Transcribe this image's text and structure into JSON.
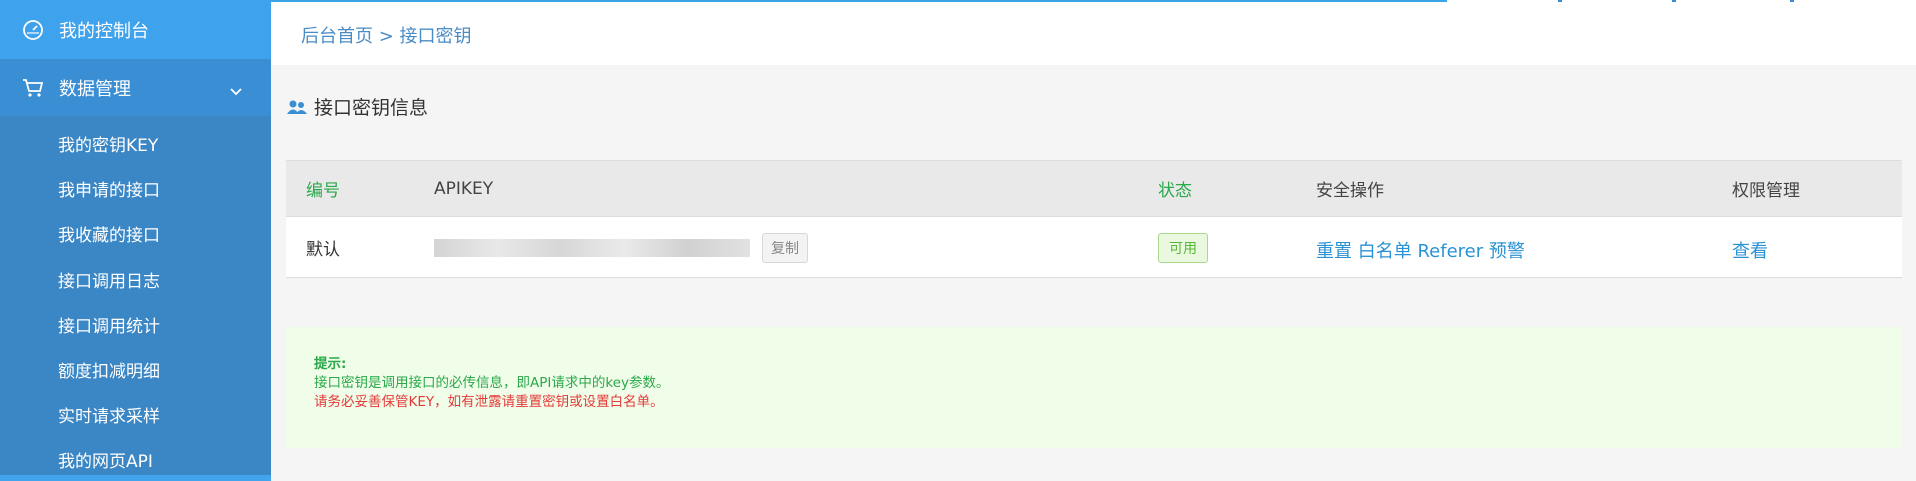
{
  "sidebar": {
    "top_item": {
      "label": "我的控制台",
      "icon": "dashboard-icon"
    },
    "group": {
      "label": "数据管理",
      "icon": "cart-icon",
      "chevron": "chevron-down-icon"
    },
    "items": [
      {
        "label": "我的密钥KEY"
      },
      {
        "label": "我申请的接口"
      },
      {
        "label": "我收藏的接口"
      },
      {
        "label": "接口调用日志"
      },
      {
        "label": "接口调用统计"
      },
      {
        "label": "额度扣减明细"
      },
      {
        "label": "实时请求采样"
      },
      {
        "label": "我的网页API"
      }
    ]
  },
  "breadcrumb": {
    "text": "后台首页 > 接口密钥"
  },
  "panel": {
    "title": "接口密钥信息",
    "icon": "users-icon"
  },
  "table": {
    "headers": {
      "id": "编号",
      "apikey": "APIKEY",
      "status": "状态",
      "ops": "安全操作",
      "perm": "权限管理"
    },
    "row": {
      "id": "默认",
      "copy_label": "复制",
      "status": "可用",
      "ops": {
        "reset": "重置",
        "whitelist": "白名单",
        "referer": "Referer",
        "alert": "预警"
      },
      "perm": "查看"
    }
  },
  "tip": {
    "title": "提示:",
    "line1": "接口密钥是调用接口的必传信息，即API请求中的key参数。",
    "line2": "请务必妥善保管KEY，如有泄露请重置密钥或设置白名单。"
  },
  "colors": {
    "sidebar": "#3d8fd1",
    "sidebar_top": "#3ea2ec",
    "link": "#2b92d4",
    "green": "#2aa94a",
    "red": "#e53a3a",
    "tip_bg": "#f0fde8"
  }
}
